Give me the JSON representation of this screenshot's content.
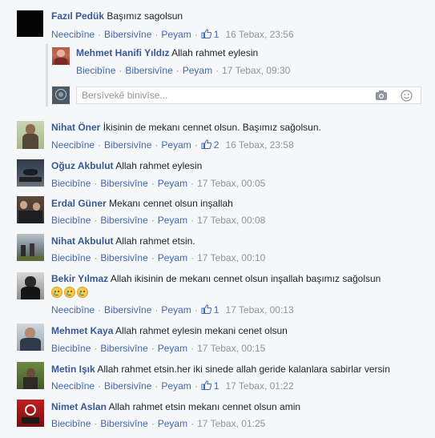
{
  "colors": {
    "link": "#4267b2",
    "author": "#365899",
    "meta": "#90949c",
    "background": "#f6f7f9"
  },
  "actions": {
    "like": "Neecibîne",
    "like_alt": "Biecibîne",
    "reply": "Bibersivîne",
    "message": "Peyam"
  },
  "reply_box": {
    "placeholder": "Bersîvekê binivîse...",
    "camera_icon": "camera-icon",
    "emoji_icon": "emoji-icon"
  },
  "comments": [
    {
      "author": "Fazıl Pedük",
      "text": "Başımız sagolsun",
      "like_label": "Neecibîne",
      "likes": "1",
      "time": "16 Tebax, 23:56"
    },
    {
      "author": "Mehmet Hanifi Yıldız",
      "text": "Allah rahmet eylesin",
      "like_label": "Biecibîne",
      "likes": "",
      "time": "17 Tebax, 09:30"
    },
    {
      "author": "Nihat Öner",
      "text": "İkisinin de mekanı cennet olsun. Başımız sağolsun.",
      "like_label": "Neecibîne",
      "likes": "2",
      "time": "16 Tebax, 23:58"
    },
    {
      "author": "Oğuz Akbulut",
      "text": "Allah rahmet eylesin",
      "like_label": "Biecibîne",
      "likes": "",
      "time": "17 Tebax, 00:05"
    },
    {
      "author": "Erdal Güner",
      "text": "Mekanı cennet olsun inşallah",
      "like_label": "Biecibîne",
      "likes": "",
      "time": "17 Tebax, 00:08"
    },
    {
      "author": "Nihat Akbulut",
      "text": "Allah rahmet etsin.",
      "like_label": "Biecibîne",
      "likes": "",
      "time": "17 Tebax, 00:10"
    },
    {
      "author": "Bekir Yılmaz",
      "text": "Allah ikisinin de mekanı cennet olsun inşallah başımız sağolsun",
      "like_label": "Neecibîne",
      "likes": "1",
      "time": "17 Tebax, 00:13"
    },
    {
      "author": "Mehmet Kaya",
      "text": "Allah rahmet eylesin mekani cenet olsun",
      "like_label": "Biecibîne",
      "likes": "",
      "time": "17 Tebax, 00:15"
    },
    {
      "author": "Metin Işık",
      "text": "Allah rahmet etsin.her iki sinede allah geride kalanlara sabirlar versin",
      "like_label": "Neecibîne",
      "likes": "1",
      "time": "17 Tebax, 01:22"
    },
    {
      "author": "Nimet Aslan",
      "text": "Allah rahmet etsin mekanı cennet olsun amin",
      "like_label": "Biecibîne",
      "likes": "",
      "time": "17 Tebax, 01:25"
    }
  ]
}
